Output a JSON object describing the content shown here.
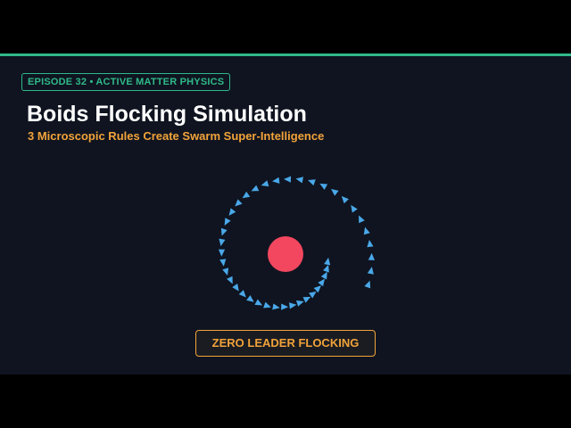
{
  "header": {
    "episode_badge": "EPISODE 32 • ACTIVE MATTER PHYSICS",
    "title": "Boids Flocking Simulation",
    "subtitle": "3 Microscopic Rules Create Swarm Super-Intelligence"
  },
  "simulation": {
    "caption": "ZERO LEADER FLOCKING",
    "boid_count": 42
  },
  "colors": {
    "background": "#0f1420",
    "accent_green": "#2fb989",
    "accent_orange": "#f2a33a",
    "boid": "#4aa8e8",
    "attractor": "#f2475f",
    "title": "#ffffff"
  }
}
